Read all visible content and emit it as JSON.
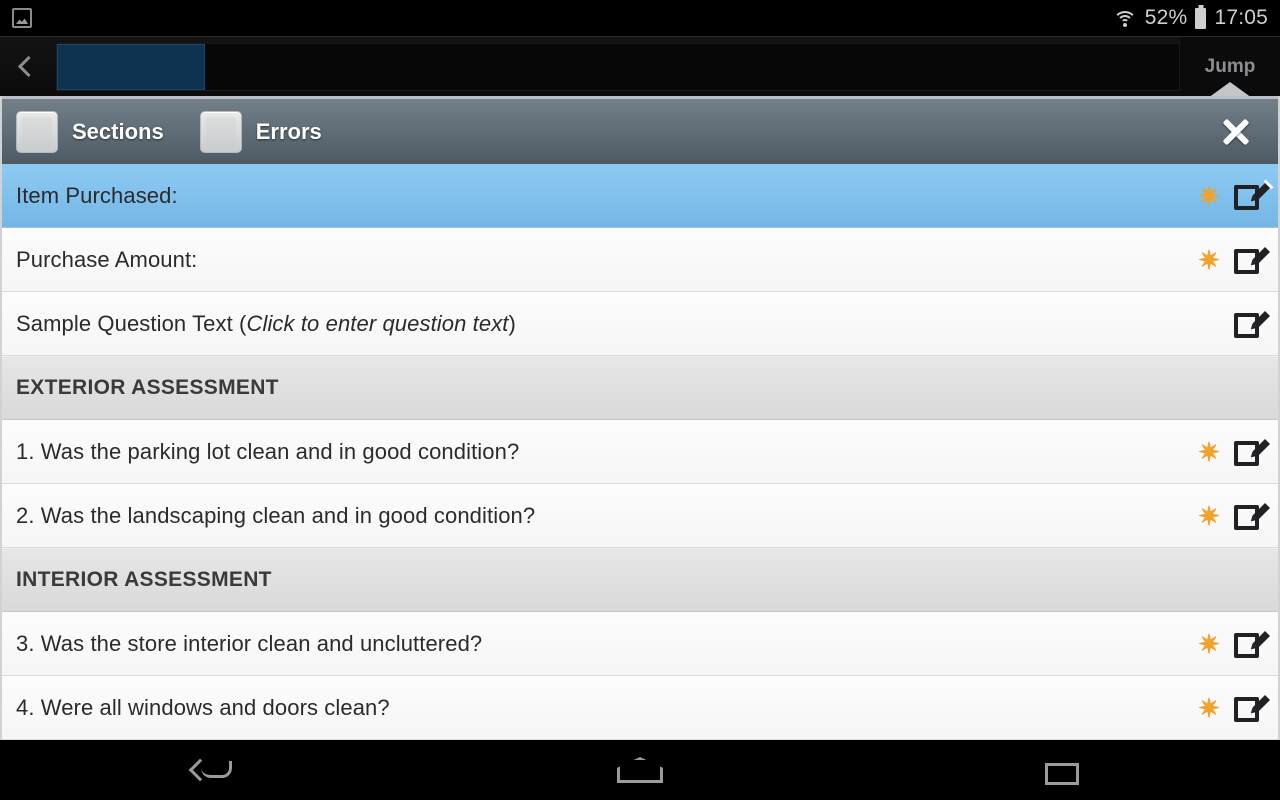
{
  "statusbar": {
    "notification_icon": "screenshot-icon",
    "wifi_icon": "wifi-icon",
    "battery_percent": "52%",
    "battery_icon": "battery-icon",
    "clock": "17:05"
  },
  "appbar": {
    "back_icon": "back-chevron-icon",
    "jump_label": "Jump"
  },
  "panel": {
    "header": {
      "sections_label": "Sections",
      "errors_label": "Errors",
      "close_icon": "close-icon"
    },
    "rows": [
      {
        "type": "item",
        "text": "Item Purchased:",
        "italic": "",
        "tail": "",
        "selected": true,
        "required": true,
        "star": "✷",
        "edit_icon": "edit-icon"
      },
      {
        "type": "item",
        "text": "Purchase Amount:",
        "italic": "",
        "tail": "",
        "selected": false,
        "required": true,
        "star": "✷",
        "edit_icon": "edit-icon"
      },
      {
        "type": "item",
        "text": "Sample Question Text (",
        "italic": "Click to enter question text",
        "tail": ")",
        "selected": false,
        "required": false,
        "star": "✷",
        "edit_icon": "edit-icon"
      },
      {
        "type": "section",
        "text": "EXTERIOR ASSESSMENT"
      },
      {
        "type": "item",
        "text": "1. Was the parking lot clean and in good condition?",
        "italic": "",
        "tail": "",
        "selected": false,
        "required": true,
        "star": "✷",
        "edit_icon": "edit-icon"
      },
      {
        "type": "item",
        "text": "2. Was the landscaping clean and in good condition?",
        "italic": "",
        "tail": "",
        "selected": false,
        "required": true,
        "star": "✷",
        "edit_icon": "edit-icon"
      },
      {
        "type": "section",
        "text": "INTERIOR ASSESSMENT"
      },
      {
        "type": "item",
        "text": "3. Was the store interior clean and uncluttered?",
        "italic": "",
        "tail": "",
        "selected": false,
        "required": true,
        "star": "✷",
        "edit_icon": "edit-icon"
      },
      {
        "type": "item",
        "text": "4. Were all windows and doors clean?",
        "italic": "",
        "tail": "",
        "selected": false,
        "required": true,
        "star": "✷",
        "edit_icon": "edit-icon"
      }
    ]
  },
  "navbar": {
    "back_icon": "nav-back-icon",
    "home_icon": "nav-home-icon",
    "recents_icon": "nav-recents-icon"
  },
  "colors": {
    "selected_row": "#8ecbf3",
    "header_gradient_top": "#737f89",
    "header_gradient_bottom": "#4d5a64",
    "required_star": "#f0a22e",
    "tab_active": "#0d3350"
  }
}
